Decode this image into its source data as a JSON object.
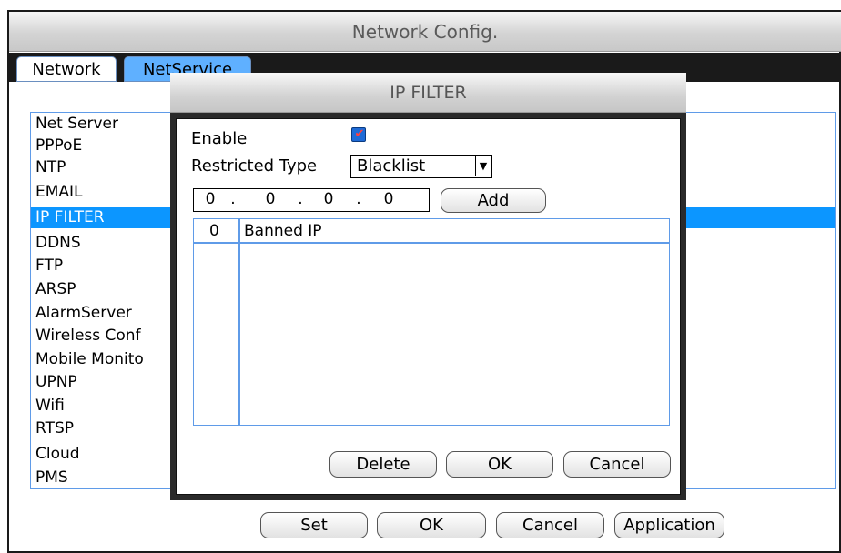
{
  "window": {
    "title": "Network Config."
  },
  "tabs": [
    {
      "label": "Network"
    },
    {
      "label": "NetService"
    }
  ],
  "list": {
    "items": [
      "Net Server",
      "PPPoE",
      "NTP",
      "EMAIL",
      "IP FILTER",
      "DDNS",
      "FTP",
      "ARSP",
      "AlarmServer",
      "Wireless Conf",
      "Mobile Monito",
      "UPNP",
      "Wifi",
      "RTSP",
      "Cloud",
      "PMS"
    ],
    "selected": "IP FILTER"
  },
  "bottom_buttons": {
    "set": "Set",
    "ok": "OK",
    "cancel": "Cancel",
    "application": "Application"
  },
  "dialog": {
    "title": "IP FILTER",
    "enable_label": "Enable",
    "enable_checked": true,
    "restricted_type_label": "Restricted Type",
    "restricted_type_value": "Blacklist",
    "ip": [
      "0",
      "0",
      "0",
      "0"
    ],
    "ip_dot": ".",
    "add_label": "Add",
    "table": {
      "index_header": "0",
      "column_header": "Banned IP"
    },
    "buttons": {
      "delete": "Delete",
      "ok": "OK",
      "cancel": "Cancel"
    }
  },
  "colors": {
    "selection": "#0c96ff",
    "tab_active": "#5fb0ff",
    "border_blue": "#5f9be8",
    "check": "#1f6bd6"
  }
}
